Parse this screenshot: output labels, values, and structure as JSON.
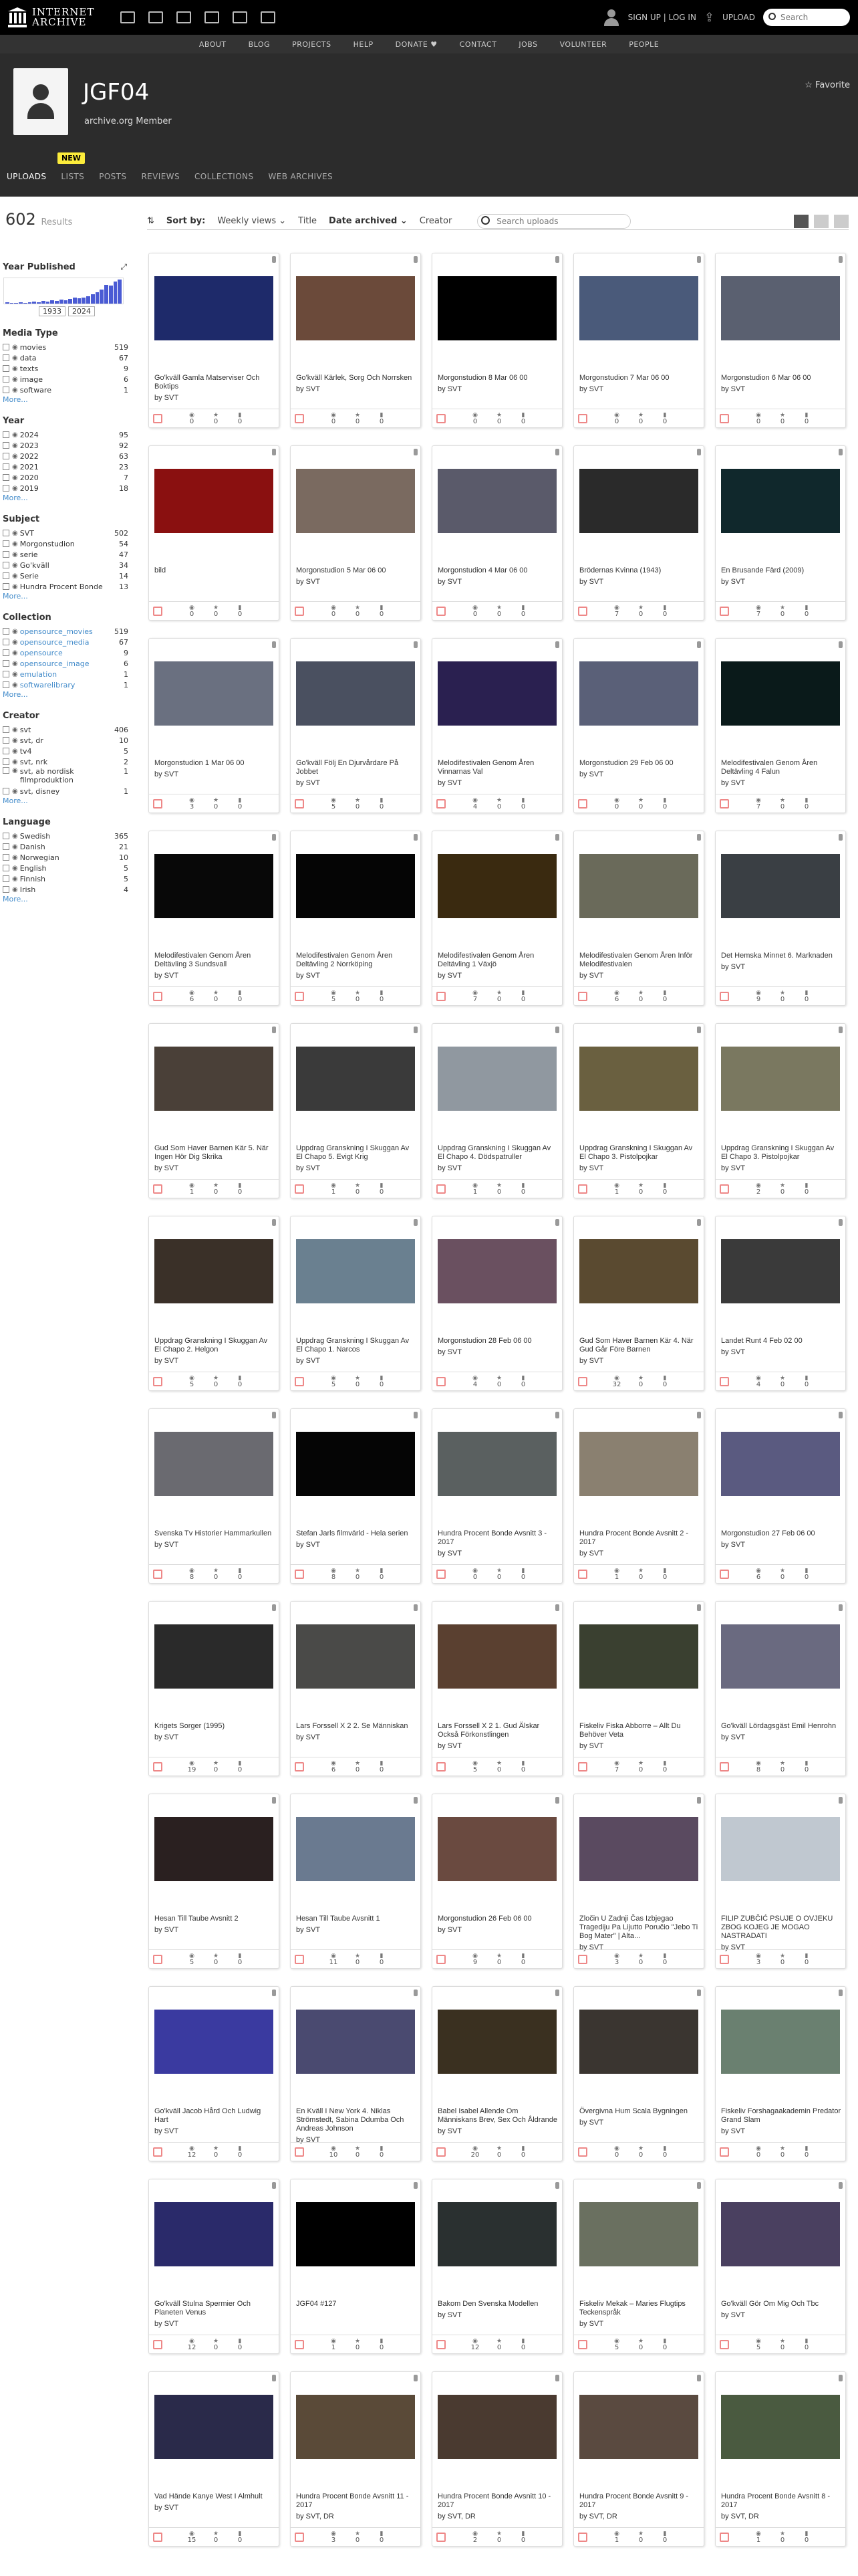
{
  "topnav": {
    "logo_line1": "INTERNET",
    "logo_line2": "ARCHIVE",
    "signup_login": "SIGN UP | LOG IN",
    "upload": "UPLOAD",
    "search_placeholder": "Search"
  },
  "subnav": [
    "ABOUT",
    "BLOG",
    "PROJECTS",
    "HELP",
    "DONATE",
    "CONTACT",
    "JOBS",
    "VOLUNTEER",
    "PEOPLE"
  ],
  "profile": {
    "name": "JGF04",
    "subtitle": "archive.org Member",
    "favorite": "Favorite",
    "new_badge": "NEW"
  },
  "tabs": [
    "UPLOADS",
    "LISTS",
    "POSTS",
    "REVIEWS",
    "COLLECTIONS",
    "WEB ARCHIVES"
  ],
  "results": {
    "count": "602",
    "label": "Results",
    "sort_by": "Sort by:",
    "sort_options": [
      "Weekly views",
      "Title",
      "Date archived",
      "Creator"
    ],
    "search_placeholder": "Search uploads"
  },
  "sidebar": {
    "year_published": {
      "title": "Year Published",
      "from": "1933",
      "to": "2024"
    },
    "media_type": {
      "title": "Media Type",
      "items": [
        [
          "movies",
          "519"
        ],
        [
          "data",
          "67"
        ],
        [
          "texts",
          "9"
        ],
        [
          "image",
          "6"
        ],
        [
          "software",
          "1"
        ]
      ]
    },
    "year": {
      "title": "Year",
      "items": [
        [
          "2024",
          "95"
        ],
        [
          "2023",
          "92"
        ],
        [
          "2022",
          "63"
        ],
        [
          "2021",
          "23"
        ],
        [
          "2020",
          "7"
        ],
        [
          "2019",
          "18"
        ]
      ]
    },
    "subject": {
      "title": "Subject",
      "items": [
        [
          "SVT",
          "502"
        ],
        [
          "Morgonstudion",
          "54"
        ],
        [
          "serie",
          "47"
        ],
        [
          "Go'kväll",
          "34"
        ],
        [
          "Serie",
          "14"
        ],
        [
          "Hundra Procent Bonde",
          "13"
        ]
      ]
    },
    "collection": {
      "title": "Collection",
      "items": [
        [
          "opensource_movies",
          "519"
        ],
        [
          "opensource_media",
          "67"
        ],
        [
          "opensource",
          "9"
        ],
        [
          "opensource_image",
          "6"
        ],
        [
          "emulation",
          "1"
        ],
        [
          "softwarelibrary",
          "1"
        ]
      ]
    },
    "creator": {
      "title": "Creator",
      "items": [
        [
          "svt",
          "406"
        ],
        [
          "svt, dr",
          "10"
        ],
        [
          "tv4",
          "5"
        ],
        [
          "svt, nrk",
          "2"
        ],
        [
          "svt, ab nordisk filmproduktion",
          "1"
        ],
        [
          "svt, disney",
          "1"
        ]
      ]
    },
    "language": {
      "title": "Language",
      "items": [
        [
          "Swedish",
          "365"
        ],
        [
          "Danish",
          "21"
        ],
        [
          "Norwegian",
          "10"
        ],
        [
          "English",
          "5"
        ],
        [
          "Finnish",
          "5"
        ],
        [
          "Irish",
          "4"
        ]
      ]
    },
    "more": "More..."
  },
  "items": [
    {
      "title": "Go'kväll Gamla Matserviser Och Boktips",
      "by": "by SVT",
      "v": "0",
      "f": "0",
      "r": "0"
    },
    {
      "title": "Go'kväll Kärlek, Sorg Och Norrsken",
      "by": "by SVT",
      "v": "0",
      "f": "0",
      "r": "0"
    },
    {
      "title": "Morgonstudion 8 Mar 06 00",
      "by": "by SVT",
      "v": "0",
      "f": "0",
      "r": "0"
    },
    {
      "title": "Morgonstudion 7 Mar 06 00",
      "by": "by SVT",
      "v": "0",
      "f": "0",
      "r": "0"
    },
    {
      "title": "Morgonstudion 6 Mar 06 00",
      "by": "by SVT",
      "v": "0",
      "f": "0",
      "r": "0"
    },
    {
      "title": "bild",
      "by": "",
      "v": "0",
      "f": "0",
      "r": "0"
    },
    {
      "title": "Morgonstudion 5 Mar 06 00",
      "by": "by SVT",
      "v": "0",
      "f": "0",
      "r": "0"
    },
    {
      "title": "Morgonstudion 4 Mar 06 00",
      "by": "by SVT",
      "v": "0",
      "f": "0",
      "r": "0"
    },
    {
      "title": "Brödernas Kvinna (1943)",
      "by": "by SVT",
      "v": "7",
      "f": "0",
      "r": "0"
    },
    {
      "title": "En Brusande Färd (2009)",
      "by": "by SVT",
      "v": "7",
      "f": "0",
      "r": "0"
    },
    {
      "title": "Morgonstudion 1 Mar 06 00",
      "by": "by SVT",
      "v": "3",
      "f": "0",
      "r": "0"
    },
    {
      "title": "Go'kväll Följ En Djurvårdare På Jobbet",
      "by": "by SVT",
      "v": "5",
      "f": "0",
      "r": "0"
    },
    {
      "title": "Melodifestivalen Genom Åren Vinnarnas Val",
      "by": "by SVT",
      "v": "4",
      "f": "0",
      "r": "0"
    },
    {
      "title": "Morgonstudion 29 Feb 06 00",
      "by": "by SVT",
      "v": "0",
      "f": "0",
      "r": "0"
    },
    {
      "title": "Melodifestivalen Genom Åren Deltävling 4 Falun",
      "by": "by SVT",
      "v": "7",
      "f": "0",
      "r": "0"
    },
    {
      "title": "Melodifestivalen Genom Åren Deltävling 3 Sundsvall",
      "by": "by SVT",
      "v": "6",
      "f": "0",
      "r": "0"
    },
    {
      "title": "Melodifestivalen Genom Åren Deltävling 2 Norrköping",
      "by": "by SVT",
      "v": "5",
      "f": "0",
      "r": "0"
    },
    {
      "title": "Melodifestivalen Genom Åren Deltävling 1 Växjö",
      "by": "by SVT",
      "v": "7",
      "f": "0",
      "r": "0"
    },
    {
      "title": "Melodifestivalen Genom Åren Inför Melodifestivalen",
      "by": "by SVT",
      "v": "6",
      "f": "0",
      "r": "0"
    },
    {
      "title": "Det Hemska Minnet 6. Marknaden",
      "by": "by SVT",
      "v": "9",
      "f": "0",
      "r": "0"
    },
    {
      "title": "Gud Som Haver Barnen Kär 5. När Ingen Hör Dig Skrika",
      "by": "by SVT",
      "v": "1",
      "f": "0",
      "r": "0"
    },
    {
      "title": "Uppdrag Granskning I Skuggan Av El Chapo 5. Evigt Krig",
      "by": "by SVT",
      "v": "1",
      "f": "0",
      "r": "0"
    },
    {
      "title": "Uppdrag Granskning I Skuggan Av El Chapo 4. Dödspatruller",
      "by": "by SVT",
      "v": "1",
      "f": "0",
      "r": "0"
    },
    {
      "title": "Uppdrag Granskning I Skuggan Av El Chapo 3. Pistolpojkar",
      "by": "by SVT",
      "v": "1",
      "f": "0",
      "r": "0"
    },
    {
      "title": "Uppdrag Granskning I Skuggan Av El Chapo 3. Pistolpojkar",
      "by": "by SVT",
      "v": "2",
      "f": "0",
      "r": "0"
    },
    {
      "title": "Uppdrag Granskning I Skuggan Av El Chapo 2. Helgon",
      "by": "by SVT",
      "v": "5",
      "f": "0",
      "r": "0"
    },
    {
      "title": "Uppdrag Granskning I Skuggan Av El Chapo 1. Narcos",
      "by": "by SVT",
      "v": "5",
      "f": "0",
      "r": "0"
    },
    {
      "title": "Morgonstudion 28 Feb 06 00",
      "by": "by SVT",
      "v": "4",
      "f": "0",
      "r": "0"
    },
    {
      "title": "Gud Som Haver Barnen Kär 4. När Gud Går Före Barnen",
      "by": "by SVT",
      "v": "32",
      "f": "0",
      "r": "0"
    },
    {
      "title": "Landet Runt 4 Feb 02 00",
      "by": "by SVT",
      "v": "4",
      "f": "0",
      "r": "0"
    },
    {
      "title": "Svenska Tv Historier Hammarkullen",
      "by": "by SVT",
      "v": "8",
      "f": "0",
      "r": "0"
    },
    {
      "title": "Stefan Jarls filmvärld - Hela serien",
      "by": "by SVT",
      "v": "8",
      "f": "0",
      "r": "0"
    },
    {
      "title": "Hundra Procent Bonde Avsnitt 3 - 2017",
      "by": "by SVT",
      "v": "0",
      "f": "0",
      "r": "0"
    },
    {
      "title": "Hundra Procent Bonde Avsnitt 2 - 2017",
      "by": "by SVT",
      "v": "1",
      "f": "0",
      "r": "0"
    },
    {
      "title": "Morgonstudion 27 Feb 06 00",
      "by": "by SVT",
      "v": "6",
      "f": "0",
      "r": "0"
    },
    {
      "title": "Krigets Sorger (1995)",
      "by": "by SVT",
      "v": "19",
      "f": "0",
      "r": "0"
    },
    {
      "title": "Lars Forssell X 2 2. Se Människan",
      "by": "by SVT",
      "v": "6",
      "f": "0",
      "r": "0"
    },
    {
      "title": "Lars Forssell X 2 1. Gud Älskar Också Förkonstlingen",
      "by": "by SVT",
      "v": "5",
      "f": "0",
      "r": "0"
    },
    {
      "title": "Fiskeliv Fiska Abborre – Allt Du Behöver Veta",
      "by": "by SVT",
      "v": "7",
      "f": "0",
      "r": "0"
    },
    {
      "title": "Go'kväll Lördagsgäst Emil Henrohn",
      "by": "by SVT",
      "v": "8",
      "f": "0",
      "r": "0"
    },
    {
      "title": "Hesan Till Taube Avsnitt 2",
      "by": "by SVT",
      "v": "5",
      "f": "0",
      "r": "0"
    },
    {
      "title": "Hesan Till Taube Avsnitt 1",
      "by": "by SVT",
      "v": "11",
      "f": "0",
      "r": "0"
    },
    {
      "title": "Morgonstudion 26 Feb 06 00",
      "by": "by SVT",
      "v": "9",
      "f": "0",
      "r": "0"
    },
    {
      "title": "Zločin U Zadnji Čas Izbjegao Tragediju Pa Lijutto Poručio \"Jebo Ti Bog Mater\" | Alta...",
      "by": "by SVT",
      "v": "3",
      "f": "0",
      "r": "0"
    },
    {
      "title": "FILIP ZUBČIĆ PSUJE O OVJEKU ZBOG KOJEG JE MOGAO NASTRADATI",
      "by": "by SVT",
      "v": "3",
      "f": "0",
      "r": "0"
    },
    {
      "title": "Go'kväll Jacob Hård Och Ludwig Hart",
      "by": "by SVT",
      "v": "12",
      "f": "0",
      "r": "0"
    },
    {
      "title": "En Kväll I New York 4. Niklas Strömstedt, Sabina Ddumba Och Andreas Johnson",
      "by": "by SVT",
      "v": "10",
      "f": "0",
      "r": "0"
    },
    {
      "title": "Babel Isabel Allende Om Människans Brev, Sex Och Åldrande",
      "by": "by SVT",
      "v": "20",
      "f": "0",
      "r": "0"
    },
    {
      "title": "Övergivna Hum Scala Bygningen",
      "by": "by SVT",
      "v": "0",
      "f": "0",
      "r": "0"
    },
    {
      "title": "Fiskeliv Forshagaakademin Predator Grand Slam",
      "by": "by SVT",
      "v": "0",
      "f": "0",
      "r": "0"
    },
    {
      "title": "Go'kväll Stulna Spermier Och Planeten Venus",
      "by": "by SVT",
      "v": "12",
      "f": "0",
      "r": "0"
    },
    {
      "title": "JGF04 #127",
      "by": "",
      "v": "1",
      "f": "0",
      "r": "0"
    },
    {
      "title": "Bakom Den Svenska Modellen",
      "by": "by SVT",
      "v": "12",
      "f": "0",
      "r": "0"
    },
    {
      "title": "Fiskeliv Mekak – Maries Flugtips Teckenspråk",
      "by": "by SVT",
      "v": "5",
      "f": "0",
      "r": "0"
    },
    {
      "title": "Go'kväll Gör Om Mig Och Tbc",
      "by": "by SVT",
      "v": "5",
      "f": "0",
      "r": "0"
    },
    {
      "title": "Vad Hände Kanye West I Almhult",
      "by": "by SVT",
      "v": "15",
      "f": "0",
      "r": "0"
    },
    {
      "title": "Hundra Procent Bonde Avsnitt 11 - 2017",
      "by": "by SVT, DR",
      "v": "3",
      "f": "0",
      "r": "0"
    },
    {
      "title": "Hundra Procent Bonde Avsnitt 10 - 2017",
      "by": "by SVT, DR",
      "v": "2",
      "f": "0",
      "r": "0"
    },
    {
      "title": "Hundra Procent Bonde Avsnitt 9 - 2017",
      "by": "by SVT, DR",
      "v": "1",
      "f": "0",
      "r": "0"
    },
    {
      "title": "Hundra Procent Bonde Avsnitt 8 - 2017",
      "by": "by SVT, DR",
      "v": "1",
      "f": "0",
      "r": "0"
    }
  ],
  "thumbs": [
    "#1e2a6a",
    "#6b4a3a",
    "#000000",
    "#4a5a7a",
    "#5a6070",
    "#8a1010",
    "#7a6a60",
    "#5a5a6a",
    "#2a2a2a",
    "#10282c",
    "#6a7080",
    "#4a5060",
    "#2a2050",
    "#5a6078",
    "#0a1a1a",
    "#080808",
    "#050505",
    "#3a2a10",
    "#6a6a5a",
    "#3a3f44",
    "#4a4038",
    "#3a3a3a",
    "#9098a0",
    "#6a6040",
    "#7a7860",
    "#3a3028",
    "#6a8090",
    "#6a5060",
    "#5a4a30",
    "#3a3a3a",
    "#6a6a70",
    "#050505",
    "#5a6060",
    "#8a8070",
    "#5a5a80",
    "#2a2a2a",
    "#4a4a48",
    "#5a4030",
    "#3a4030",
    "#6a6a80",
    "#2a2020",
    "#6a7a90",
    "#6a4a40",
    "#5a4a60",
    "#c0c8d0",
    "#3a3aa0",
    "#4a4a70",
    "#3a3020",
    "#3a3530",
    "#6a8070",
    "#2a2a6a",
    "#000000",
    "#2a3030",
    "#6a7060",
    "#4a4060",
    "#2a2a4a",
    "#5a4a38",
    "#4a3a30",
    "#5a4a40",
    "#4a5a40"
  ]
}
